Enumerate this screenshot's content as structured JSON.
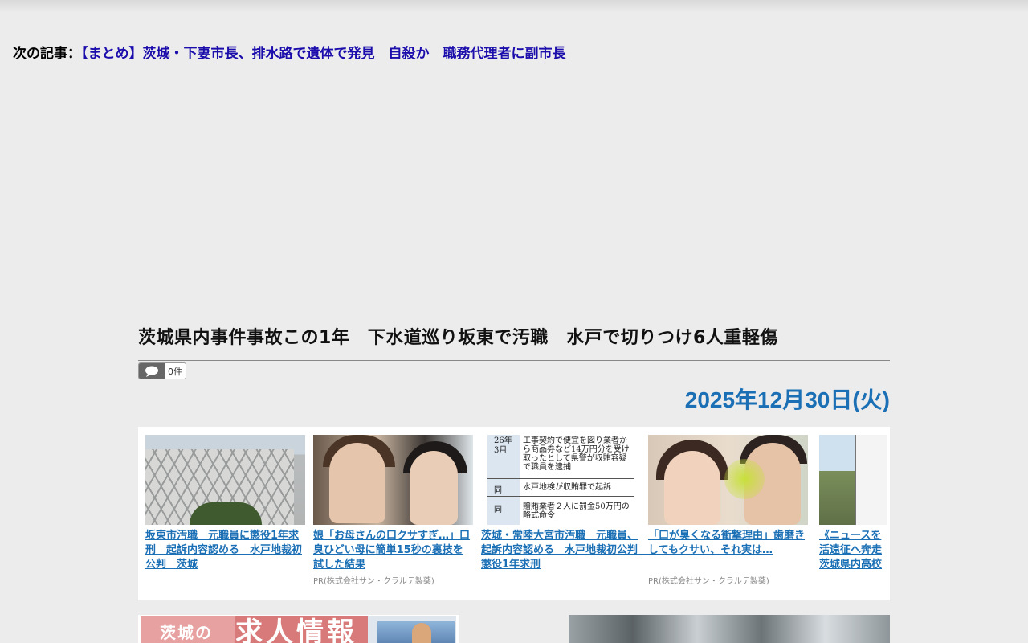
{
  "next_article": {
    "label": "次の記事：",
    "link": "【まとめ】茨城・下妻市長、排水路で遺体で発見　自殺か　職務代理者に副市長"
  },
  "article": {
    "title": "茨城県内事件事故この1年　下水道巡り坂東で汚職　水戸で切りつけ6人重軽傷",
    "comment_count": "0件",
    "date": "2025年12月30日(火)"
  },
  "related": [
    {
      "title": "坂東市汚職　元職員に懲役1年求刑　起訴内容認める　水戸地裁初公判　茨城",
      "sponsor": ""
    },
    {
      "title": "娘「お母さんの口クサすぎ…」口臭ひどい母に簡単15秒の裏技を試した結果",
      "sponsor": "PR(株式会社サン・クラルテ製薬)"
    },
    {
      "title": "茨城・常陸大宮市汚職　元職員、起訴内容認める　水戸地裁初公判　懲役1年求刑",
      "sponsor": ""
    },
    {
      "title": "「口が臭くなる衝撃理由」歯磨きしてもクサい、それ実は…",
      "sponsor": "PR(株式会社サン・クラルテ製薬)"
    },
    {
      "title": "《ニュースを活遠征へ奔走茨城県内高校",
      "sponsor": ""
    }
  ],
  "thumb3": {
    "r1_label": "26年3月",
    "r1_text": "工事契約で便宜を図り業者から商品券など14万円分を受け取ったとして県警が収賄容疑で職員を逮捕",
    "r2_label": "同",
    "r2_text": "水戸地検が収賄罪で起訴",
    "r3_label": "同",
    "r3_text": "贈賄業者２人に罰金50万円の略式命令"
  },
  "banner": {
    "left_text": "茨城の",
    "main_text": "求人情報"
  }
}
